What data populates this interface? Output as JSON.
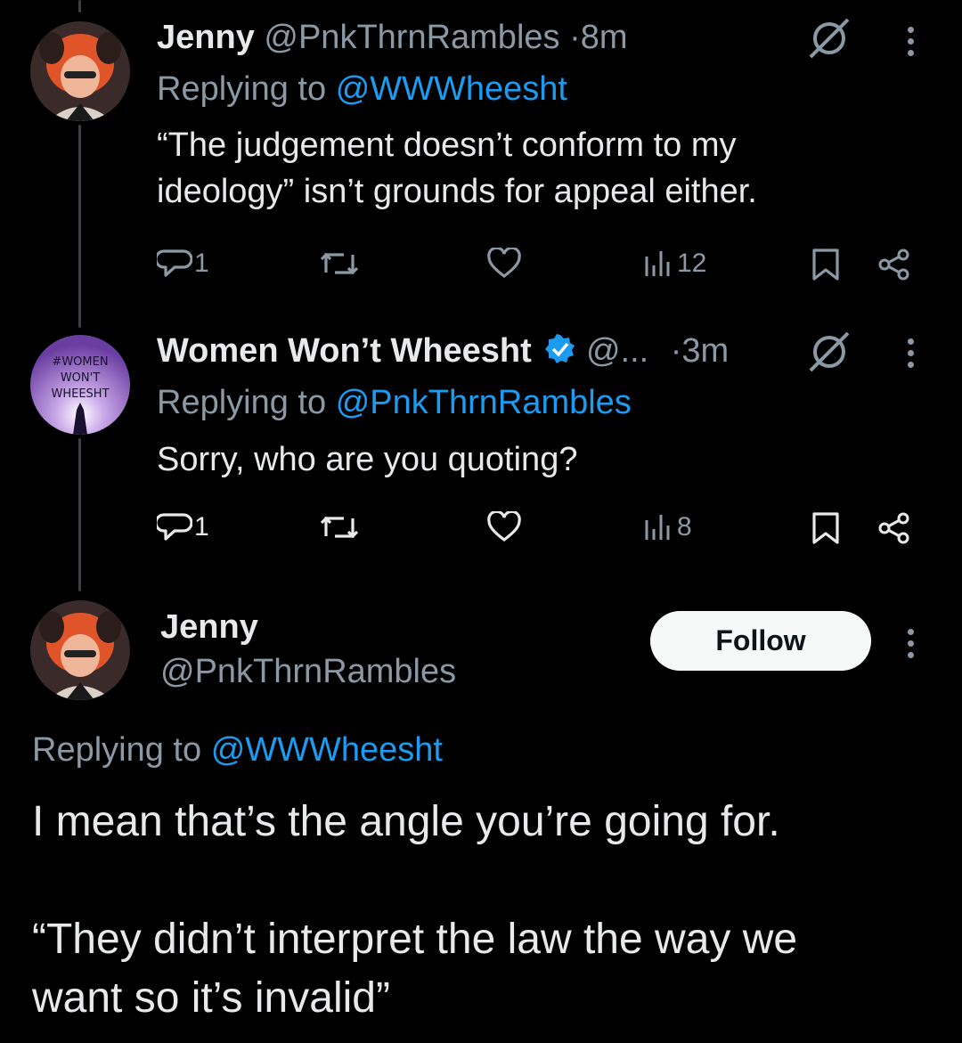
{
  "tweets": [
    {
      "name": "Jenny",
      "handle": "@PnkThrnRambles",
      "dot": "·",
      "time": "8m",
      "replying_prefix": "Replying to",
      "replying_to": "@WWWheesht",
      "text_line1": "“The judgement doesn’t conform to my",
      "text_line2": "ideology” isn’t grounds for appeal either.",
      "replies": "1",
      "views": "12"
    },
    {
      "name": "Women Won’t Wheesht",
      "handle": "@...",
      "dot": "·",
      "time": "3m",
      "replying_prefix": "Replying to",
      "replying_to": "@PnkThrnRambles",
      "text_line1": "Sorry, who are you quoting?",
      "replies": "1",
      "views": "8",
      "avatar_text": [
        "#WOMEN",
        "WON'T",
        "WHEESHT"
      ],
      "verified_color": "#1d9bf0"
    }
  ],
  "focus": {
    "name": "Jenny",
    "handle": "@PnkThrnRambles",
    "follow_label": "Follow",
    "replying_prefix": "Replying to",
    "replying_to": "@WWWheesht",
    "text_line1": "I mean that’s the angle you’re going for.",
    "text_line2": "“They didn’t interpret the law the way we",
    "text_line3": "want so it’s invalid”"
  },
  "colors": {
    "background": "#000000",
    "text": "#e7e9ea",
    "muted": "#8b98a5",
    "link": "#1d9bf0"
  },
  "icons": [
    "grok-icon",
    "more-icon",
    "reply-icon",
    "retweet-icon",
    "like-icon",
    "views-icon",
    "bookmark-icon",
    "share-icon",
    "verified-badge-icon"
  ]
}
